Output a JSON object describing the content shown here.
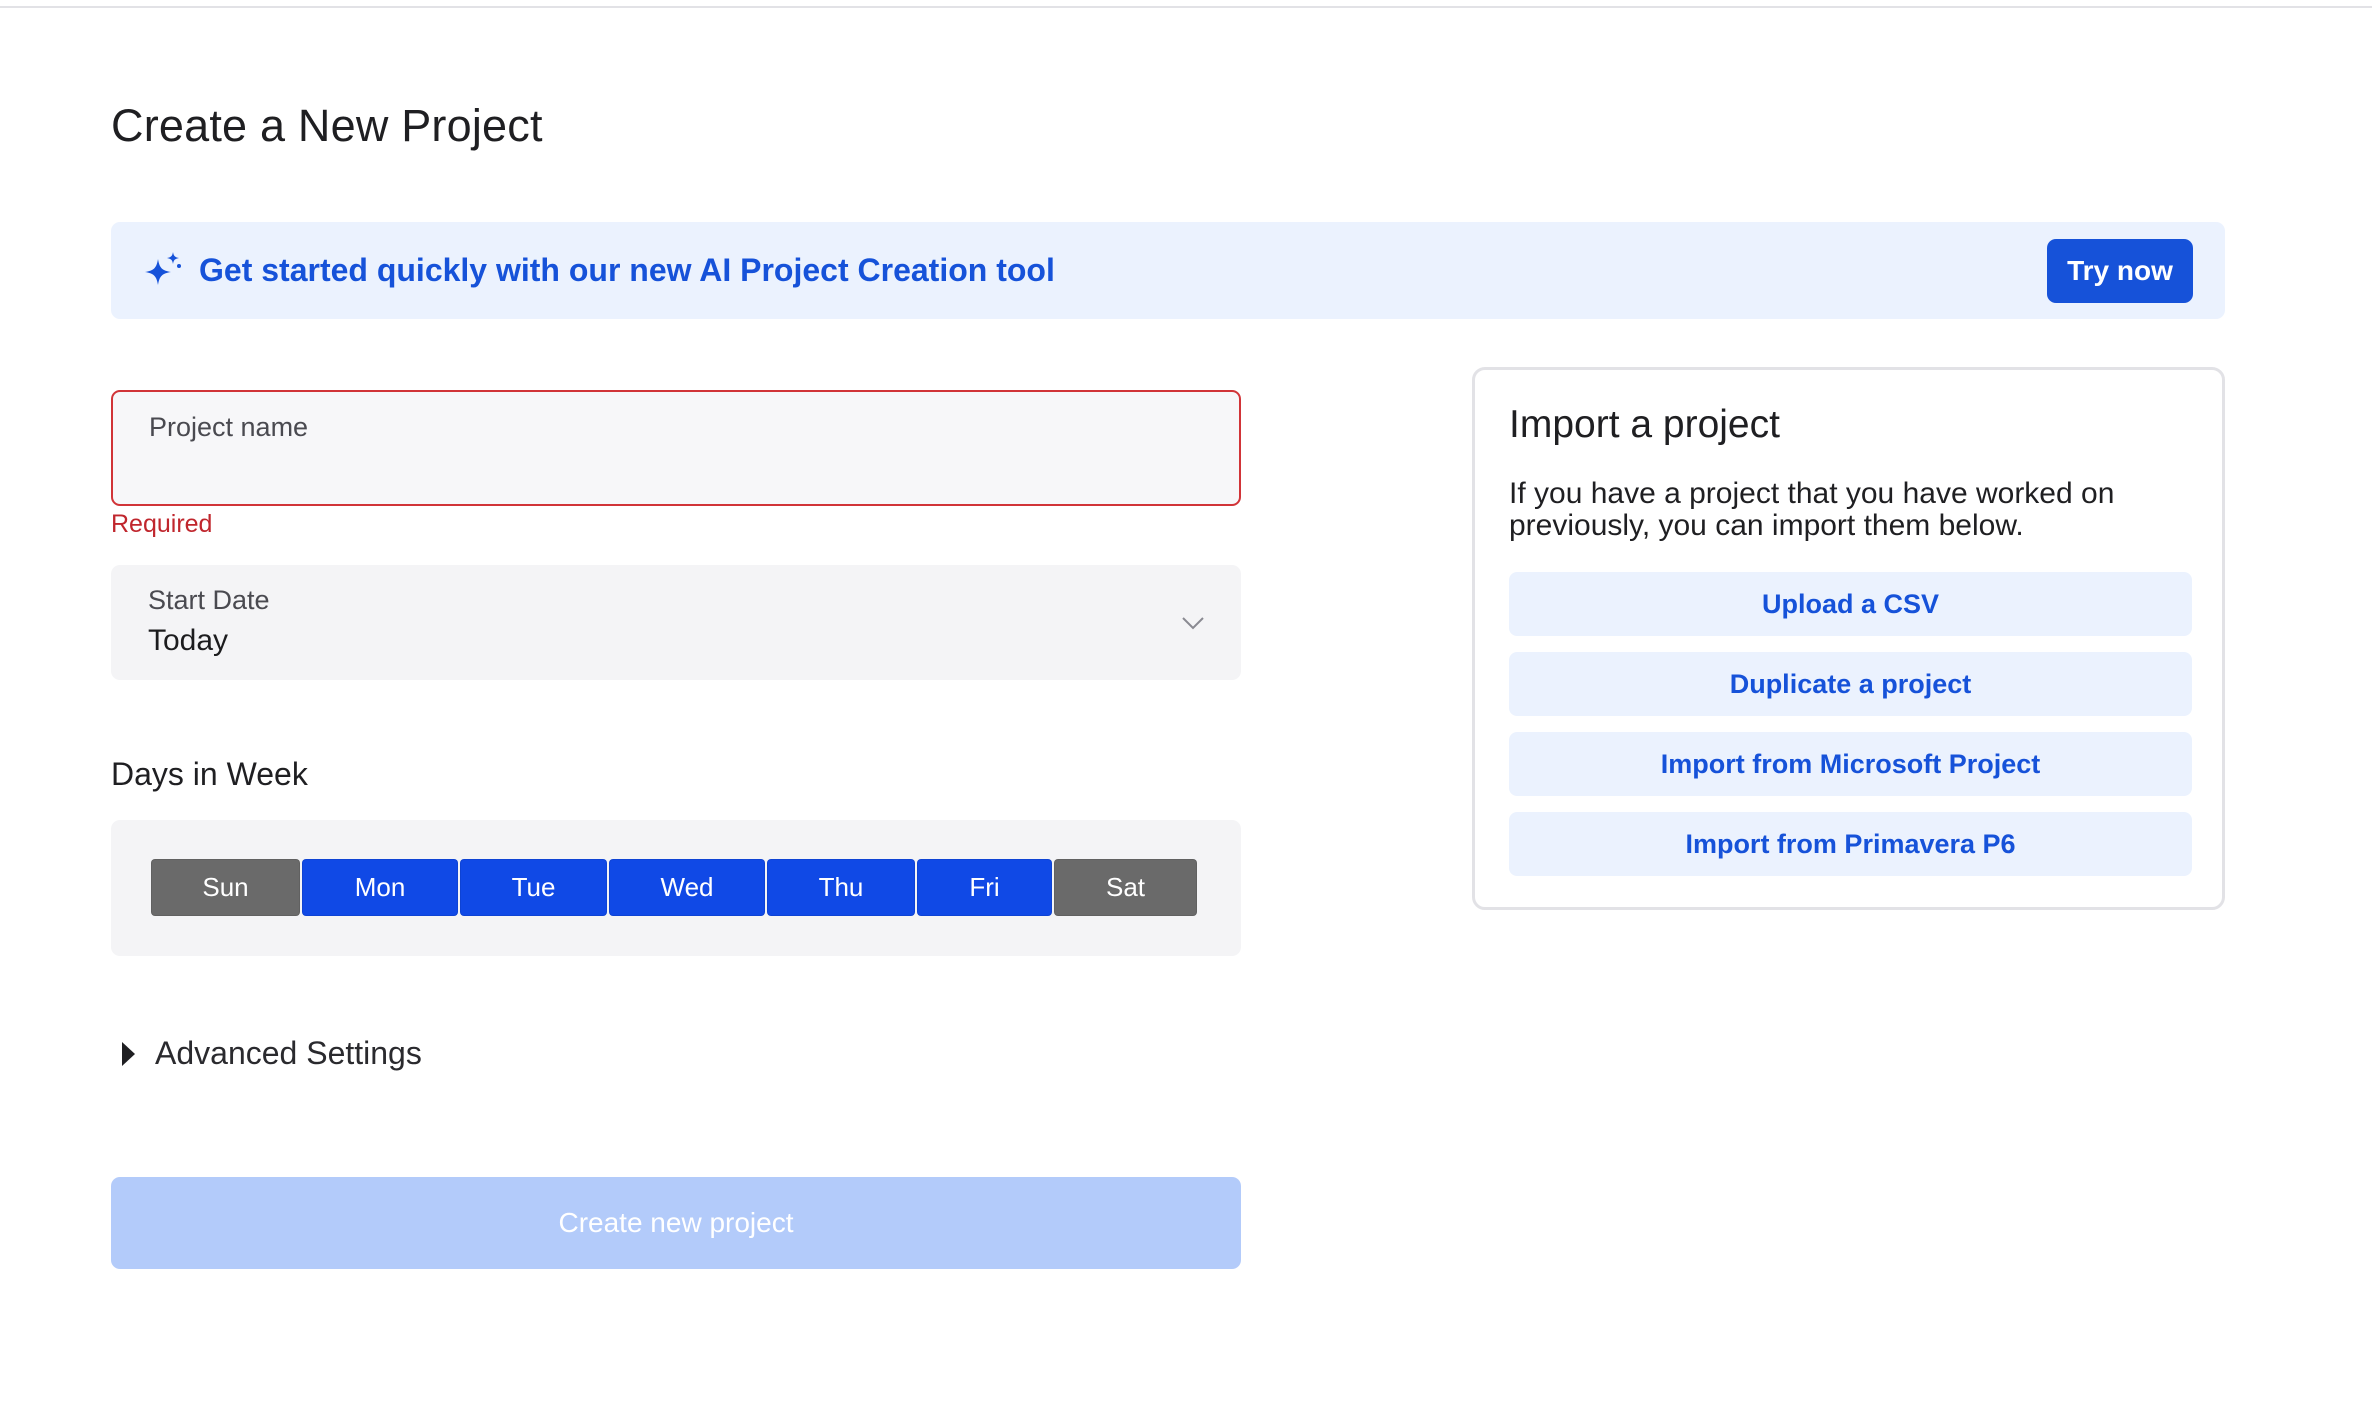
{
  "page": {
    "title": "Create a New Project"
  },
  "banner": {
    "icon": "sparkle-icon",
    "text": "Get started quickly with our new AI Project Creation tool",
    "button_label": "Try now"
  },
  "form": {
    "project_name": {
      "label": "Project name",
      "value": "",
      "error": "Required"
    },
    "start_date": {
      "label": "Start Date",
      "value": "Today"
    },
    "days_title": "Days in Week",
    "days": [
      {
        "label": "Sun",
        "selected": false
      },
      {
        "label": "Mon",
        "selected": true
      },
      {
        "label": "Tue",
        "selected": true
      },
      {
        "label": "Wed",
        "selected": true
      },
      {
        "label": "Thu",
        "selected": true
      },
      {
        "label": "Fri",
        "selected": true
      },
      {
        "label": "Sat",
        "selected": false
      }
    ],
    "advanced_label": "Advanced Settings",
    "submit_label": "Create new project"
  },
  "import": {
    "title": "Import a project",
    "description": "If you have a project that you have worked on previously, you can import them below.",
    "buttons": [
      "Upload a CSV",
      "Duplicate a project",
      "Import from Microsoft Project",
      "Import from Primavera P6"
    ]
  },
  "colors": {
    "accent": "#1652d9",
    "day_on": "#1049e6",
    "day_off": "#6a6a6a",
    "error": "#c0262d",
    "banner_bg": "#ebf2fe",
    "disabled_btn": "#b3cbfa"
  }
}
